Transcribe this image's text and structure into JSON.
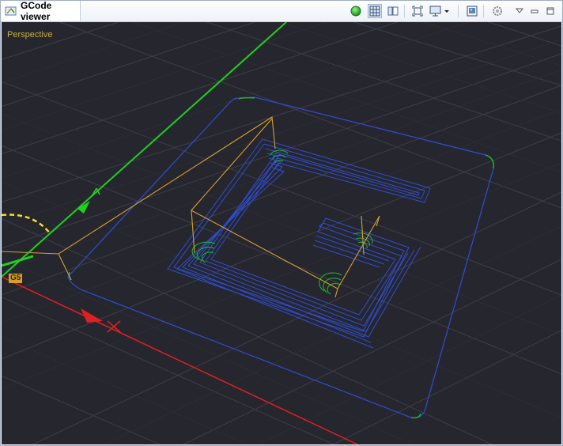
{
  "window": {
    "tab_title": "GCode viewer"
  },
  "toolbar": {
    "buttons": [
      {
        "name": "status-indicator",
        "icon": "green-circle-icon",
        "color": "#2db82d"
      },
      {
        "name": "grid-toggle",
        "icon": "grid-icon",
        "active": true
      },
      {
        "name": "split-view",
        "icon": "split-view-icon"
      },
      {
        "name": "zoom-to-fit",
        "icon": "fit-frame-icon"
      },
      {
        "name": "display-mode",
        "icon": "monitor-icon",
        "has_dropdown": true
      },
      {
        "name": "snapshot",
        "icon": "image-icon"
      },
      {
        "name": "settings",
        "icon": "gear-icon"
      }
    ],
    "window_controls": [
      "view-menu-icon",
      "minimize-icon",
      "maximize-icon"
    ]
  },
  "viewport": {
    "view_label": "Perspective",
    "origin_badge": "G5",
    "background": "#26262e",
    "colors": {
      "grid": "#3c3c46",
      "x_axis": "#e02020",
      "y_axis": "#20d020",
      "toolpath": "#2f4fd0",
      "travel": "#d8a030",
      "arcs": "#20b030",
      "yellow_arc": "#f0e020"
    }
  }
}
